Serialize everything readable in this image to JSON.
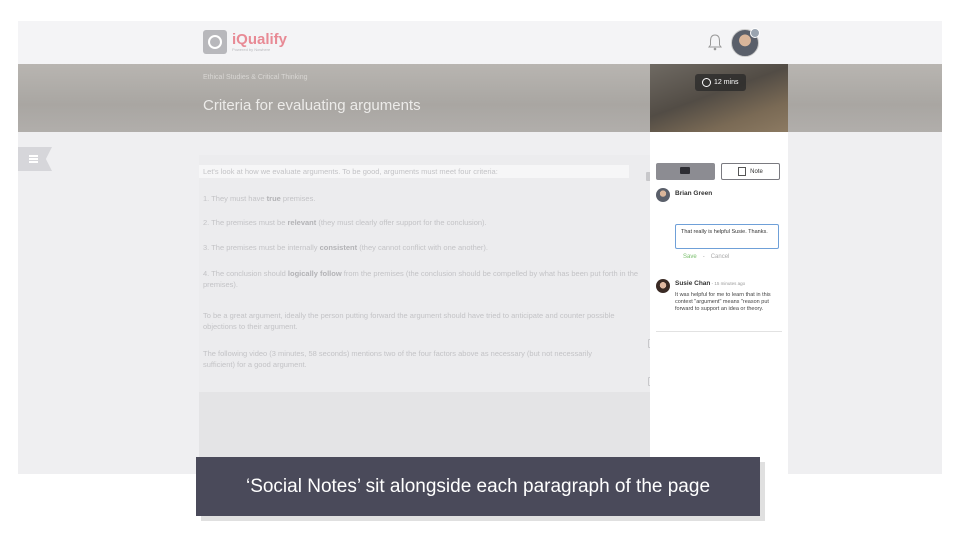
{
  "app": {
    "logo_text": "iQualify",
    "logo_sub": "Powered by Nowhere"
  },
  "header": {
    "breadcrumb": "Ethical Studies & Critical Thinking",
    "title": "Criteria for evaluating arguments",
    "timer": "12 mins"
  },
  "content": {
    "paragraphs": [
      {
        "text": "Let's look at how we evaluate arguments. To be good, arguments must meet four criteria:"
      },
      {
        "pre": "1. They must have ",
        "bold": "true",
        "post": " premises."
      },
      {
        "pre": "2. The premises must be ",
        "bold": "relevant",
        "post": " (they must clearly offer support for the conclusion)."
      },
      {
        "pre": "3. The premises must be internally ",
        "bold": "consistent",
        "post": " (they cannot conflict with one another)."
      },
      {
        "pre": "4. The conclusion should ",
        "bold": "logically follow",
        "post": " from the premises (the conclusion should be compelled by what has been put forth in the premises)."
      },
      {
        "text": "To be a great argument, ideally the person putting forward the argument should have tried to anticipate and counter possible objections to their argument."
      },
      {
        "text": "The following video (3 minutes, 58 seconds) mentions two of the four factors above as necessary (but not necessarily sufficient) for a good argument."
      }
    ]
  },
  "notes_panel": {
    "note_button_label": "Note",
    "reply": {
      "author": "Brian Green",
      "value": "That really is helpful Susie. Thanks.",
      "save_label": "Save",
      "separator": "-",
      "cancel_label": "Cancel"
    },
    "comment": {
      "author": "Susie Chan",
      "time": " - 15 minutes ago",
      "text": "It was helpful for me to learn that in this context \"argument\" means \"reason put forward to support an idea or theory."
    }
  },
  "caption": "‘Social Notes’ sit alongside each paragraph of the page",
  "colors": {
    "logo": "#e88a95",
    "save": "#7abf6d",
    "input_border": "#6fa0d8",
    "caption_bg": "#4a4a5a"
  }
}
